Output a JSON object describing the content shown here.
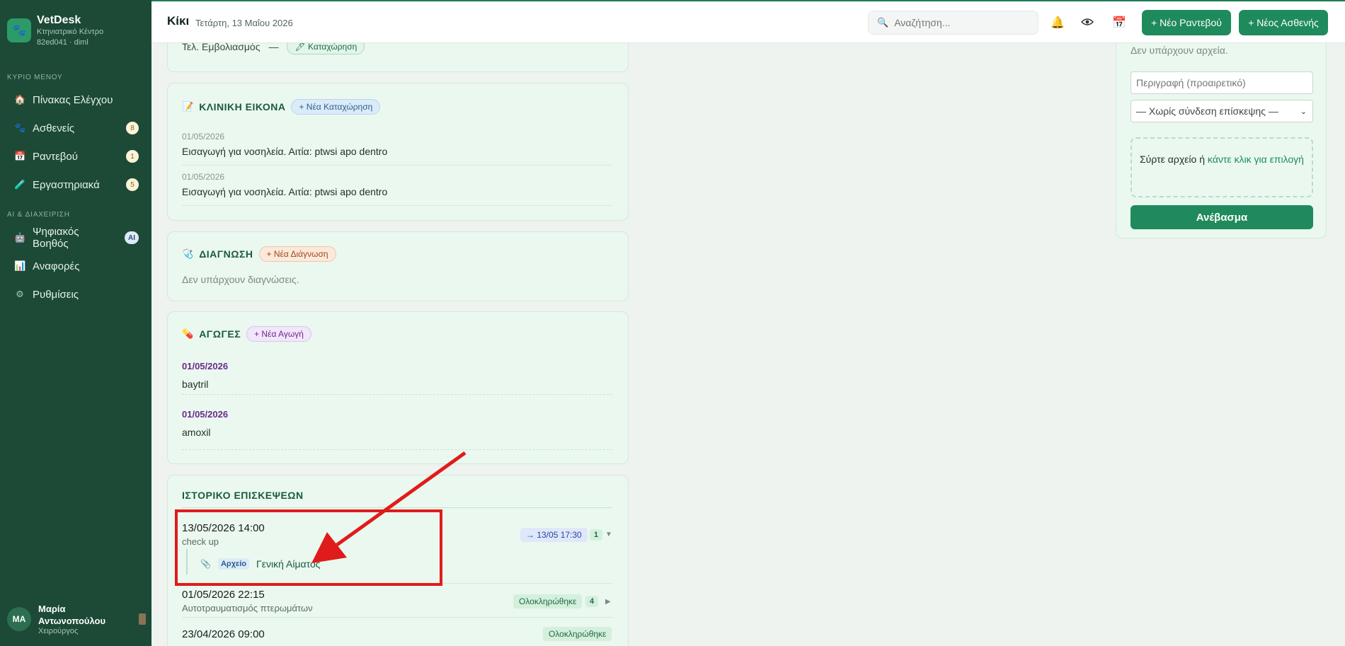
{
  "sidebar": {
    "brand": {
      "name": "VetDesk",
      "subtitle": "Κτηνιατρικό Κέντρο",
      "meta": "82ed041 · diml"
    },
    "section_main": "ΚΥΡΙΟ ΜΕΝΟΥ",
    "section_ai": "AI & ΔΙΑΧΕΙΡΙΣΗ",
    "items": [
      {
        "label": "Πίνακας Ελέγχου",
        "icon": "🏠",
        "badge": ""
      },
      {
        "label": "Ασθενείς",
        "icon": "🐾",
        "badge": "8"
      },
      {
        "label": "Ραντεβού",
        "icon": "📅",
        "badge": "1"
      },
      {
        "label": "Εργαστηριακά",
        "icon": "🧪",
        "badge": "5"
      },
      {
        "label": "Ψηφιακός Βοηθός",
        "icon": "🤖",
        "badge": "AI"
      },
      {
        "label": "Αναφορές",
        "icon": "📊",
        "badge": ""
      },
      {
        "label": "Ρυθμίσεις",
        "icon": "⚙",
        "badge": ""
      }
    ],
    "user": {
      "initials": "MA",
      "name_line1": "Μαρία",
      "name_line2": "Αντωνοπούλου",
      "role": "Χειρούργος"
    }
  },
  "header": {
    "title": "Κίκι",
    "date": "Τετάρτη, 13 Μαΐου 2026",
    "search_placeholder": "Αναζήτηση...",
    "new_appointment": "+ Νέο Ραντεβού",
    "new_patient": "+ Νέος Ασθενής"
  },
  "vaccination_partial": {
    "text": "Τελ. Εμβολιασμός",
    "dash": "—",
    "button": "Καταχώρηση"
  },
  "clinical": {
    "title": "ΚΛΙΝΙΚΗ ΕΙΚΟΝΑ",
    "icon": "📝",
    "add_button": "+ Νέα Καταχώρηση",
    "entries": [
      {
        "date": "01/05/2026",
        "text": "Εισαγωγή για νοσηλεία. Αιτία: ptwsi apo dentro"
      },
      {
        "date": "01/05/2026",
        "text": "Εισαγωγή για νοσηλεία. Αιτία: ptwsi apo dentro"
      }
    ]
  },
  "diagnosis": {
    "title": "ΔΙΑΓΝΩΣΗ",
    "icon": "🩺",
    "add_button": "+ Νέα Διάγνωση",
    "empty": "Δεν υπάρχουν διαγνώσεις."
  },
  "treatments": {
    "title": "ΑΓΩΓΕΣ",
    "icon": "💊",
    "add_button": "+ Νέα Αγωγή",
    "items": [
      {
        "date": "01/05/2026",
        "text": "baytril"
      },
      {
        "date": "01/05/2026",
        "text": "amoxil"
      }
    ]
  },
  "history": {
    "title": "ΙΣΤΟΡΙΚΟ ΕΠΙΣΚΕΨΕΩΝ",
    "visits": [
      {
        "datetime": "13/05/2026 14:00",
        "reason": "check up",
        "followup": "→ 13/05 17:30",
        "count": "1",
        "chevron": "▼",
        "attachment": {
          "icon": "📎",
          "type": "Αρχείο",
          "name": "Γενική Αίματος"
        }
      },
      {
        "datetime": "01/05/2026 22:15",
        "reason": "Αυτοτραυματισμός πτερωμάτων",
        "status": "Ολοκληρώθηκε",
        "count": "4",
        "chevron": "▶"
      },
      {
        "datetime": "23/04/2026 09:00",
        "status": "Ολοκληρώθηκε"
      }
    ]
  },
  "files": {
    "empty": "Δεν υπάρχουν αρχεία.",
    "description_placeholder": "Περιγραφή (προαιρετικό)",
    "visit_select": "— Χωρίς σύνδεση επίσκεψης —",
    "drop_text": "Σύρτε αρχείο ή",
    "drop_link": "κάντε κλικ για επιλογή",
    "upload_button": "Ανέβασμα"
  },
  "colors": {
    "primary": "#1f8a5c",
    "sidebar": "#1c4a36",
    "card": "#eaf8ef",
    "annotation": "#e01b1b"
  }
}
